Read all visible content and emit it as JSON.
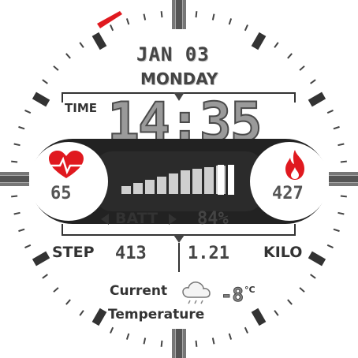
{
  "date": {
    "month_day": "JAN 03",
    "weekday": "MONDAY"
  },
  "time": {
    "label": "TIME",
    "value": "14:35"
  },
  "heart": {
    "icon": "heart-rate-icon",
    "value": "65",
    "color": "#e0191f"
  },
  "calories": {
    "icon": "flame-icon",
    "value": "427",
    "color": "#e0191f"
  },
  "battery": {
    "label": "BATT",
    "percent_text": "84%",
    "level": 0.84
  },
  "stats": {
    "steps_label": "STEP",
    "steps_value": "413",
    "distance_value": "1.21",
    "distance_label": "KILO"
  },
  "weather": {
    "label_line1": "Current",
    "label_line2": "Temperature",
    "icon": "cloud-icon",
    "value": "-8",
    "unit": "°C"
  },
  "colors": {
    "accent": "#e0191f",
    "dark": "#222222",
    "bar": "#d8d8d8"
  }
}
